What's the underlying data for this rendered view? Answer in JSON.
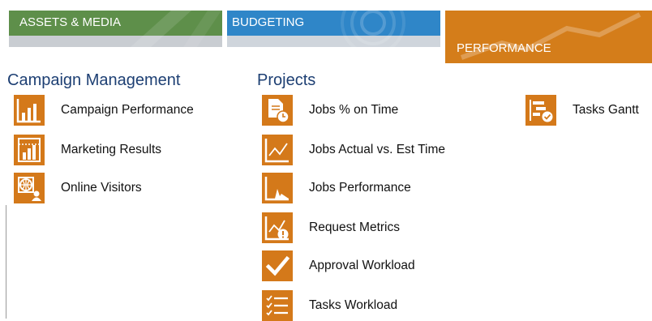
{
  "tabs": {
    "assets": "ASSETS & MEDIA",
    "budgeting": "BUDGETING",
    "performance": "PERFORMANCE"
  },
  "colors": {
    "assets_tab": "#5e8f4a",
    "budgeting_tab": "#2f86c8",
    "performance_tab": "#d47d1a",
    "icon_tile": "#d4791a",
    "section_title": "#1d3f73"
  },
  "campaign_management": {
    "title": "Campaign Management",
    "items": [
      {
        "label": "Campaign Performance",
        "icon": "bar-chart-icon"
      },
      {
        "label": "Marketing Results",
        "icon": "results-chart-icon"
      },
      {
        "label": "Online Visitors",
        "icon": "globe-user-icon"
      }
    ]
  },
  "projects": {
    "title": "Projects",
    "items": [
      {
        "label": "Jobs % on Time",
        "icon": "document-clock-icon"
      },
      {
        "label": "Jobs Actual vs. Est Time",
        "icon": "line-chart-icon"
      },
      {
        "label": "Jobs Performance",
        "icon": "spike-chart-icon"
      },
      {
        "label": "Request Metrics",
        "icon": "chart-alert-icon"
      },
      {
        "label": "Approval Workload",
        "icon": "checkmark-icon"
      },
      {
        "label": "Tasks Workload",
        "icon": "checklist-icon"
      }
    ]
  },
  "other": {
    "items": [
      {
        "label": "Tasks Gantt",
        "icon": "gantt-icon"
      }
    ]
  }
}
